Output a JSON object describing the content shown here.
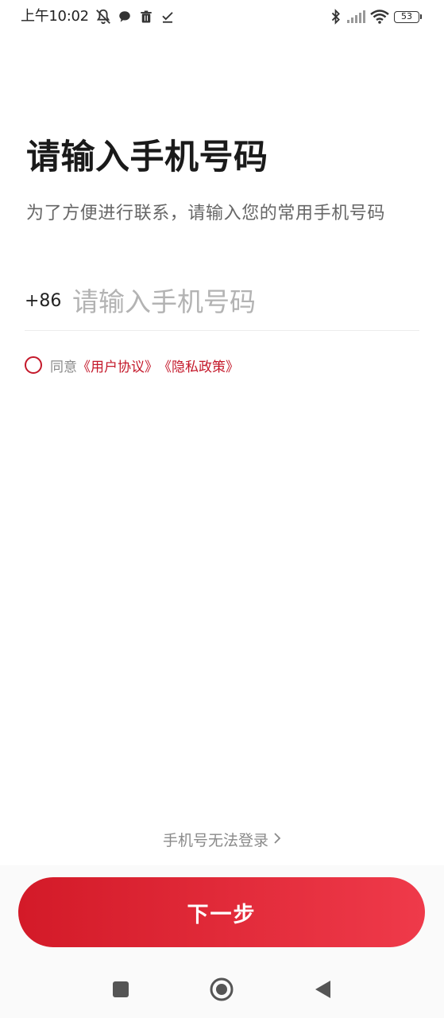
{
  "status_bar": {
    "time": "上午10:02",
    "left_icons": [
      "mute-bell-icon",
      "chat-bubble-icon",
      "trash-icon",
      "check-download-icon"
    ],
    "right_icons": [
      "bluetooth-icon",
      "signal-icon",
      "wifi-icon",
      "battery-icon"
    ],
    "battery_level": "53"
  },
  "page": {
    "title": "请输入手机号码",
    "subtitle": "为了方便进行联系，请输入您的常用手机号码"
  },
  "phone": {
    "country_code": "+86",
    "placeholder": "请输入手机号码",
    "value": ""
  },
  "agreement": {
    "checked": false,
    "prefix": "同意",
    "user_agreement": "《用户协议》",
    "privacy_policy": "《隐私政策》"
  },
  "cannot_login": {
    "label": "手机号无法登录"
  },
  "next_button": {
    "label": "下一步"
  },
  "colors": {
    "accent": "#c4182a",
    "button_start": "#d31a28",
    "button_end": "#ef3a4a",
    "text_primary": "#1a1a1a",
    "text_secondary": "#666666",
    "placeholder": "#b3b3b3"
  },
  "nav_bar": {
    "buttons": [
      "recent-apps-icon",
      "home-icon",
      "back-icon"
    ]
  }
}
